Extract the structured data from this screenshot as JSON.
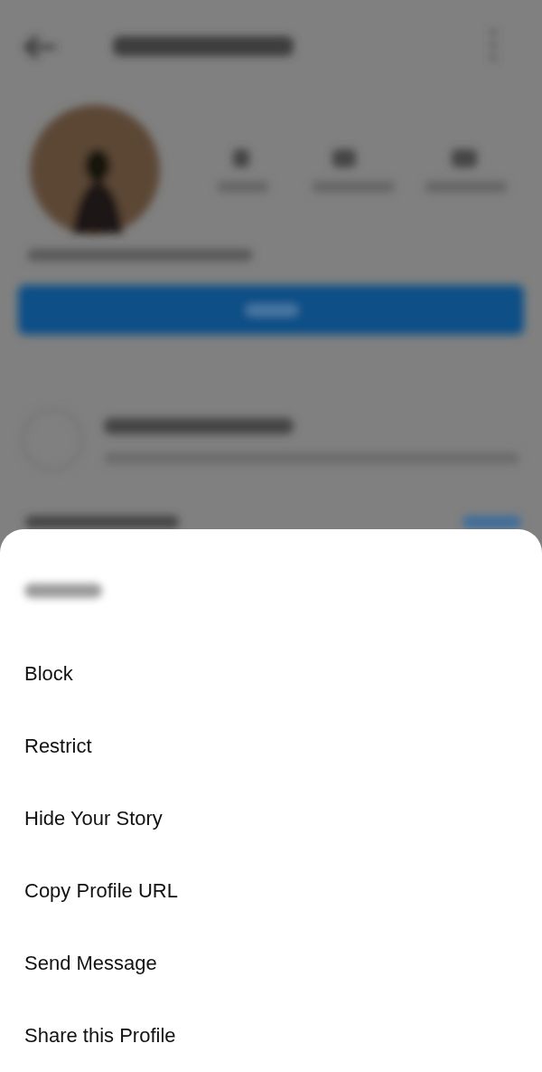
{
  "sheet": {
    "items": [
      {
        "kind": "redacted"
      },
      {
        "kind": "option",
        "label": "Block"
      },
      {
        "kind": "option",
        "label": "Restrict"
      },
      {
        "kind": "option",
        "label": "Hide Your Story"
      },
      {
        "kind": "option",
        "label": "Copy Profile URL"
      },
      {
        "kind": "option",
        "label": "Send Message"
      },
      {
        "kind": "option",
        "label": "Share this Profile"
      }
    ]
  }
}
